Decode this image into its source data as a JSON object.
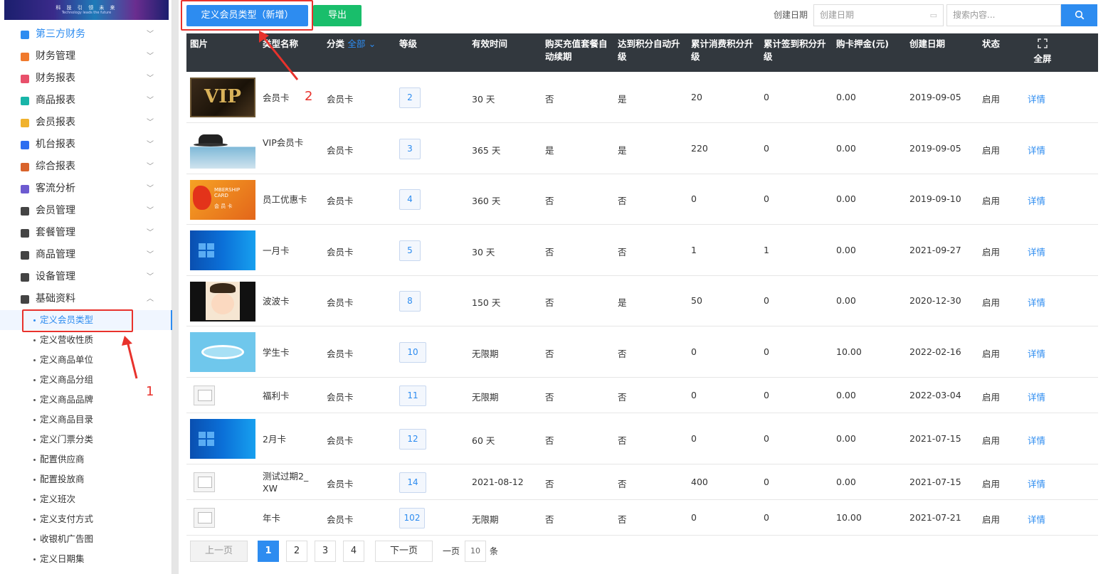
{
  "logo": {
    "slogan": "科 技 引 领 未 来",
    "sub": "Technology leads the future"
  },
  "sidebar": {
    "items": [
      {
        "label": "第三方财务",
        "color": "#2d8cf0",
        "icon": "calculator-icon"
      },
      {
        "label": "财务管理",
        "color": "#f07a2d",
        "icon": "finance-icon"
      },
      {
        "label": "财务报表",
        "color": "#e8506b",
        "icon": "report-icon"
      },
      {
        "label": "商品报表",
        "color": "#19b5a8",
        "icon": "goods-report-icon"
      },
      {
        "label": "会员报表",
        "color": "#f0b22d",
        "icon": "member-report-icon"
      },
      {
        "label": "机台报表",
        "color": "#2d6ef0",
        "icon": "machine-report-icon"
      },
      {
        "label": "综合报表",
        "color": "#d9632b",
        "icon": "layers-icon"
      },
      {
        "label": "客流分析",
        "color": "#6d5bd0",
        "icon": "target-icon"
      },
      {
        "label": "会员管理",
        "color": "#444444",
        "icon": "user-icon"
      },
      {
        "label": "套餐管理",
        "color": "#444444",
        "icon": "edit-icon"
      },
      {
        "label": "商品管理",
        "color": "#444444",
        "icon": "swap-icon"
      },
      {
        "label": "设备管理",
        "color": "#444444",
        "icon": "stethoscope-icon"
      },
      {
        "label": "基础资料",
        "color": "#444444",
        "icon": "document-icon"
      }
    ],
    "subitems": [
      "定义会员类型",
      "定义营收性质",
      "定义商品单位",
      "定义商品分组",
      "定义商品品牌",
      "定义商品目录",
      "定义门票分类",
      "配置供应商",
      "配置投放商",
      "定义班次",
      "定义支付方式",
      "收银机广告图",
      "定义日期集"
    ]
  },
  "toolbar": {
    "new_label": "定义会员类型（新增）",
    "export_label": "导出",
    "date_label": "创建日期",
    "date_placeholder": "创建日期",
    "search_placeholder": "搜索内容...",
    "search_icon": "search-icon"
  },
  "table": {
    "headers": {
      "img": "图片",
      "name": "类型名称",
      "cat": "分类",
      "cat_filter": "全部",
      "level": "等级",
      "valid": "有效时间",
      "renew1": "购买充值套餐自",
      "renew2": "动续期",
      "auto1": "达到积分自动升",
      "auto2": "级",
      "spend1": "累计消费积分升",
      "spend2": "级",
      "sign1": "累计签到积分升",
      "sign2": "级",
      "deposit": "购卡押金(元)",
      "date": "创建日期",
      "status": "状态",
      "full": "全屏"
    },
    "rows": [
      {
        "img": "vip-black",
        "name": "会员卡",
        "cat": "会员卡",
        "level": "2",
        "valid": "30 天",
        "renew": "否",
        "auto": "是",
        "spend": "20",
        "sign": "0",
        "deposit": "0.00",
        "date": "2019-09-05",
        "status": "启用",
        "action": "详情"
      },
      {
        "img": "vip-hat",
        "name": "VIP会员卡",
        "cat": "会员卡",
        "level": "3",
        "valid": "365 天",
        "renew": "是",
        "auto": "是",
        "spend": "220",
        "sign": "0",
        "deposit": "0.00",
        "date": "2019-09-05",
        "status": "启用",
        "action": "详情"
      },
      {
        "img": "orange",
        "name": "员工优惠卡",
        "cat": "会员卡",
        "level": "4",
        "valid": "360 天",
        "renew": "否",
        "auto": "否",
        "spend": "0",
        "sign": "0",
        "deposit": "0.00",
        "date": "2019-09-10",
        "status": "启用",
        "action": "详情"
      },
      {
        "img": "windows",
        "name": "一月卡",
        "cat": "会员卡",
        "level": "5",
        "valid": "30 天",
        "renew": "否",
        "auto": "否",
        "spend": "1",
        "sign": "1",
        "deposit": "0.00",
        "date": "2021-09-27",
        "status": "启用",
        "action": "详情"
      },
      {
        "img": "cartoon",
        "name": "波波卡",
        "cat": "会员卡",
        "level": "8",
        "valid": "150 天",
        "renew": "否",
        "auto": "是",
        "spend": "50",
        "sign": "0",
        "deposit": "0.00",
        "date": "2020-12-30",
        "status": "启用",
        "action": "详情"
      },
      {
        "img": "coin",
        "name": "学生卡",
        "cat": "会员卡",
        "level": "10",
        "valid": "无限期",
        "renew": "否",
        "auto": "否",
        "spend": "0",
        "sign": "0",
        "deposit": "10.00",
        "date": "2022-02-16",
        "status": "启用",
        "action": "详情"
      },
      {
        "img": "none",
        "name": "福利卡",
        "cat": "会员卡",
        "level": "11",
        "valid": "无限期",
        "renew": "否",
        "auto": "否",
        "spend": "0",
        "sign": "0",
        "deposit": "0.00",
        "date": "2022-03-04",
        "status": "启用",
        "action": "详情"
      },
      {
        "img": "windows",
        "name": "2月卡",
        "cat": "会员卡",
        "level": "12",
        "valid": "60 天",
        "renew": "否",
        "auto": "否",
        "spend": "0",
        "sign": "0",
        "deposit": "0.00",
        "date": "2021-07-15",
        "status": "启用",
        "action": "详情"
      },
      {
        "img": "none",
        "name": "测试过期2_XW",
        "cat": "会员卡",
        "level": "14",
        "valid": "2021-08-12",
        "renew": "否",
        "auto": "否",
        "spend": "400",
        "sign": "0",
        "deposit": "0.00",
        "date": "2021-07-15",
        "status": "启用",
        "action": "详情"
      },
      {
        "img": "none",
        "name": "年卡",
        "cat": "会员卡",
        "level": "102",
        "valid": "无限期",
        "renew": "否",
        "auto": "否",
        "spend": "0",
        "sign": "0",
        "deposit": "10.00",
        "date": "2021-07-21",
        "status": "启用",
        "action": "详情"
      }
    ]
  },
  "pagination": {
    "prev": "上一页",
    "pages": [
      "1",
      "2",
      "3",
      "4"
    ],
    "current": "1",
    "next": "下一页",
    "per_label": "一页",
    "per_value": "10",
    "per_unit": "条"
  },
  "annotations": {
    "one": "1",
    "two": "2"
  },
  "images": {
    "vip_text": "VIP",
    "membership": "MBERSHIP CARD",
    "member_card": "会 员 卡"
  }
}
